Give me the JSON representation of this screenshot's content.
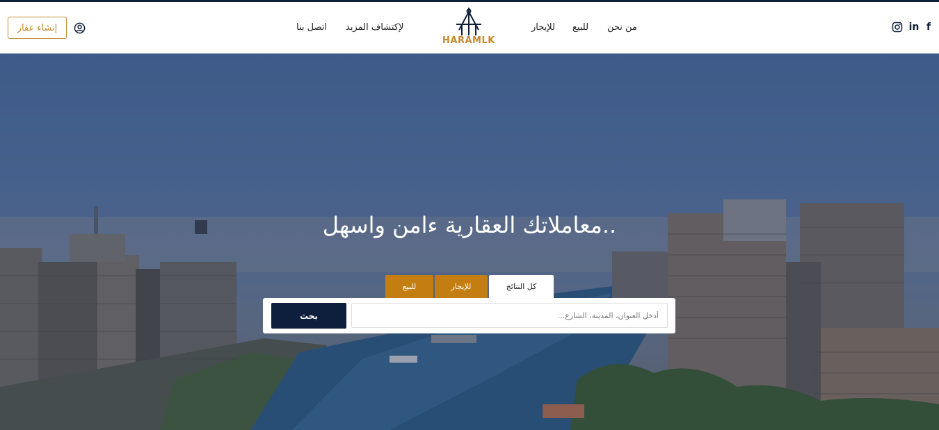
{
  "header": {
    "create_button": "إنشاء عقار",
    "nav": {
      "contact": "اتصل بنا",
      "discover": "لإكتشاف المزيد",
      "rent": "للإيجار",
      "sale": "للبيع",
      "about": "من نحن"
    },
    "logo_text": "HARAMLK",
    "social": {
      "instagram_icon": "instagram-icon",
      "linkedin_label": "in",
      "facebook_label": "f"
    }
  },
  "hero": {
    "headline": "معاملاتك العقارية ءامن واسهل..",
    "tabs": [
      "كل النتائج",
      "للإيجار",
      "للبيع"
    ],
    "search": {
      "placeholder": "أدخل العنوان، المدينة، الشارع...",
      "button": "بحث"
    }
  },
  "colors": {
    "brand_navy": "#0d1f3c",
    "brand_gold": "#c47d10",
    "accent_gold": "#c48a2c"
  }
}
